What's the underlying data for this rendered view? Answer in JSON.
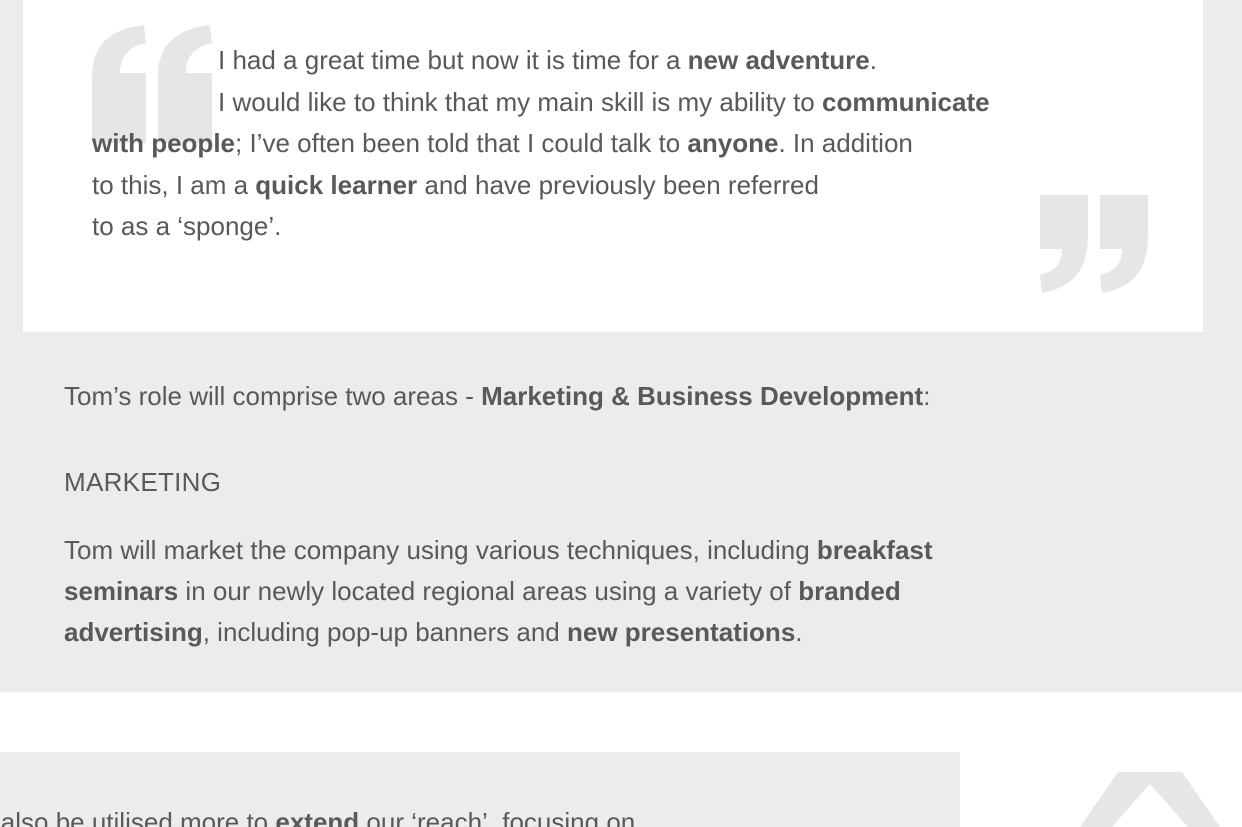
{
  "quote": {
    "line1": {
      "a": "I had a great time but now it is time for a ",
      "b": "new adventure",
      "c": "."
    },
    "line2": {
      "a": "I would like to think that my main skill is my ability to ",
      "b": "communicate"
    },
    "line3": {
      "b": "with people",
      "a": "; I’ve often been told that I could talk to ",
      "b2": "anyone",
      "c": ". In addition"
    },
    "line4": {
      "a": "to this, I am a ",
      "b": "quick learner",
      "c": " and have previously been referred"
    },
    "line5": {
      "a": "to as a ‘sponge’."
    }
  },
  "role": {
    "intro": "Tom’s role will comprise two areas - ",
    "intro_bold": "Marketing & Business Development",
    "intro_end": ":"
  },
  "marketing": {
    "heading": "MARKETING",
    "line1": {
      "a": "Tom will market the company using various techniques, including ",
      "b": "breakfast"
    },
    "line2": {
      "b": "seminars",
      "a": " in our newly located regional areas using a variety of ",
      "b2": "branded"
    },
    "line3": {
      "b": "advertising",
      "a": ", including pop-up banners and ",
      "b2": "new presentations",
      "c": "."
    }
  },
  "bottom": {
    "a": "ll also be utilised more to ",
    "b": "extend",
    "c": " our ‘reach’, focusing on"
  },
  "colors": {
    "text": "#595959",
    "band": "#ececec",
    "card": "#ffffff",
    "quote_mark": "#e6e6e6"
  }
}
